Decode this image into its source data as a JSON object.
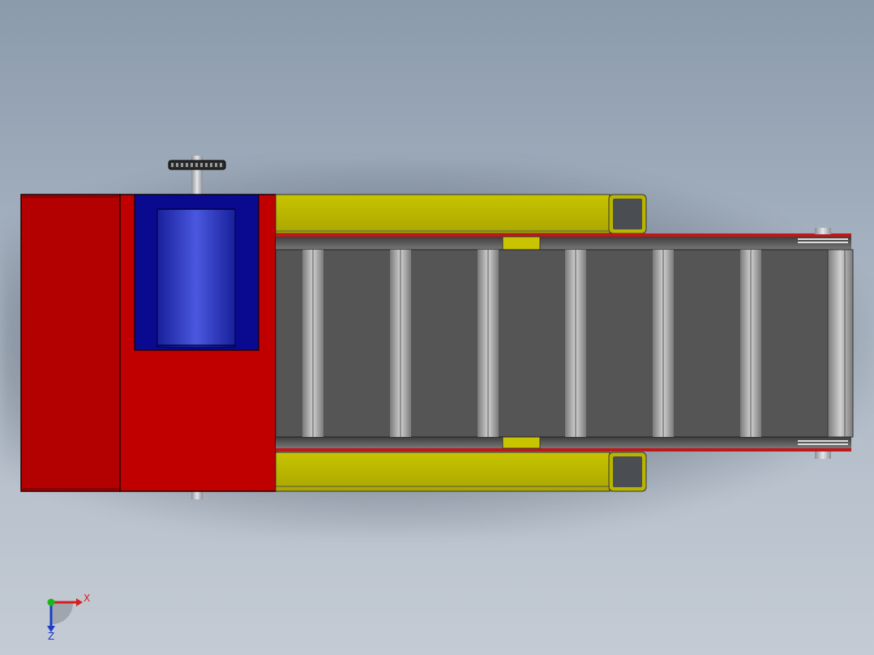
{
  "triad": {
    "x_label": "X",
    "z_label": "Z",
    "x_color": "#d42020",
    "y_color": "#18b818",
    "z_color": "#1a3cc8"
  },
  "colors": {
    "motor_housing": "#b80000",
    "motor_cover": "#0a0a90",
    "motor_drum": "#2a35b8",
    "side_rail": "#b8b400",
    "belt": "#555555",
    "roller": "#a8a8a8",
    "edge_strip": "#c01818"
  }
}
